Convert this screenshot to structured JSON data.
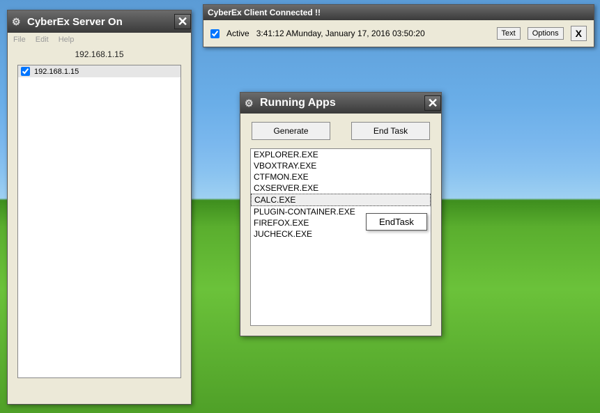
{
  "server": {
    "title": "CyberEx Server On",
    "menu": {
      "file": "File",
      "edit": "Edit",
      "help": "Help"
    },
    "ip_display": "192.168.1.15",
    "clients": [
      {
        "checked": true,
        "ip": "192.168.1.15"
      }
    ]
  },
  "client": {
    "title": "CyberEx Client Connected !!",
    "active_checked": true,
    "active_label": "Active",
    "time": "3:41:12 AMunday, January 17, 2016  03:50:20",
    "text_btn": "Text",
    "options_btn": "Options",
    "close_btn": "X"
  },
  "apps": {
    "title": "Running Apps",
    "generate_btn": "Generate",
    "endtask_btn": "End Task",
    "list": [
      "EXPLORER.EXE",
      "VBOXTRAY.EXE",
      "CTFMON.EXE",
      "CXSERVER.EXE",
      "CALC.EXE",
      "PLUGIN-CONTAINER.EXE",
      "FIREFOX.EXE",
      "JUCHECK.EXE"
    ],
    "selected_index": 4,
    "context_menu": "EndTask"
  }
}
